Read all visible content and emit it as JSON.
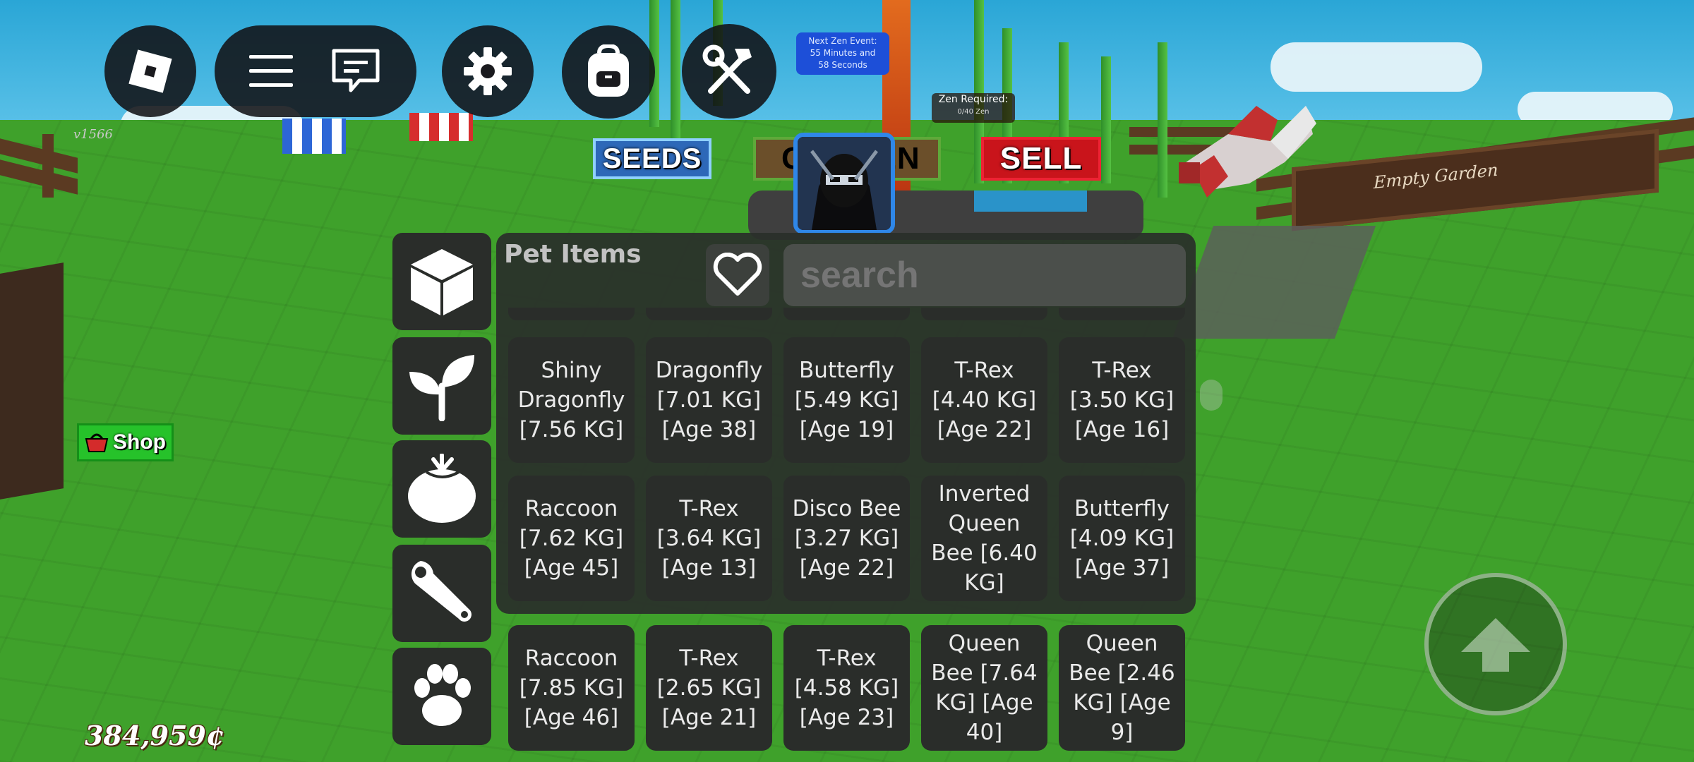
{
  "hud": {
    "version": "v1566",
    "coins": "384,959¢",
    "shop_label": "Shop",
    "seeds_label": "SEEDS",
    "garden_label": "GARDEN",
    "sell_label": "SELL",
    "zen_event_line1": "Next Zen Event:",
    "zen_event_line2": "55 Minutes and",
    "zen_event_line3": "58 Seconds",
    "zen_required_title": "Zen Required:",
    "zen_required_value": "0/40 Zen",
    "empty_garden": "Empty Garden"
  },
  "inventory": {
    "title": "Pet Items",
    "search_placeholder": "search",
    "side_tabs": [
      "cube-icon",
      "sprout-icon",
      "tomato-icon",
      "wrench-icon",
      "paw-icon"
    ],
    "rows": [
      [
        {
          "label": "Shiny Dragonfly [7.56 KG]"
        },
        {
          "label": "Dragonfly [7.01 KG] [Age 38]"
        },
        {
          "label": "Butterfly [5.49 KG] [Age 19]"
        },
        {
          "label": "T-Rex [4.40 KG] [Age 22]"
        },
        {
          "label": "T-Rex [3.50 KG] [Age 16]"
        }
      ],
      [
        {
          "label": "Raccoon [7.62 KG] [Age 45]"
        },
        {
          "label": "T-Rex [3.64 KG] [Age 13]"
        },
        {
          "label": "Disco Bee [3.27 KG] [Age 22]"
        },
        {
          "label": "Inverted Queen Bee [6.40 KG]"
        },
        {
          "label": "Butterfly [4.09 KG] [Age 37]"
        }
      ],
      [
        {
          "label": "Raccoon [7.85 KG] [Age 46]"
        },
        {
          "label": "T-Rex [2.65 KG] [Age 21]"
        },
        {
          "label": "T-Rex [4.58 KG] [Age 23]"
        },
        {
          "label": "Queen Bee [7.64 KG] [Age 40]"
        },
        {
          "label": "Queen Bee [2.46 KG] [Age 9]"
        }
      ]
    ]
  },
  "colors": {
    "panel": "#2a302a",
    "seeds": "#2d68b8",
    "sell": "#c9141b",
    "shop": "#26c22a",
    "avatar_border": "#2f87e8"
  }
}
